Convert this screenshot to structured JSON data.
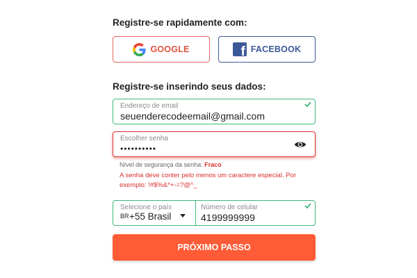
{
  "social": {
    "heading": "Registre-se rapidamente com:",
    "google_label": "GOOGLE",
    "facebook_label": "FACEBOOK"
  },
  "form": {
    "heading": "Registre-se inserindo seus dados:",
    "email": {
      "label": "Endereço de email",
      "value": "seuenderecodeemail@gmail.com"
    },
    "password": {
      "label": "Escolher senha",
      "value": "••••••••••"
    },
    "strength": {
      "label": "Nível de segurança da senha:",
      "value": "Fraco"
    },
    "error_line1": "A senha deve conter pelo menos um caractere especial. Por",
    "error_line2": "exemplo: !#$%&*+-=?@^_",
    "country": {
      "label": "Selecione o país",
      "code": "BR",
      "value": "+55 Brasil"
    },
    "phone": {
      "label": "Número de celular",
      "value": "4199999999"
    },
    "next_label": "PRÓXIMO PASSO"
  },
  "colors": {
    "accent": "#ff5b36",
    "success": "#3fb87a",
    "error": "#d8302e",
    "facebook": "#3b5998",
    "google_border": "#e0665c"
  },
  "icons": {
    "google": "google-icon",
    "facebook": "facebook-icon",
    "check": "check-icon",
    "eye": "eye-icon",
    "caret": "caret-down-icon"
  }
}
